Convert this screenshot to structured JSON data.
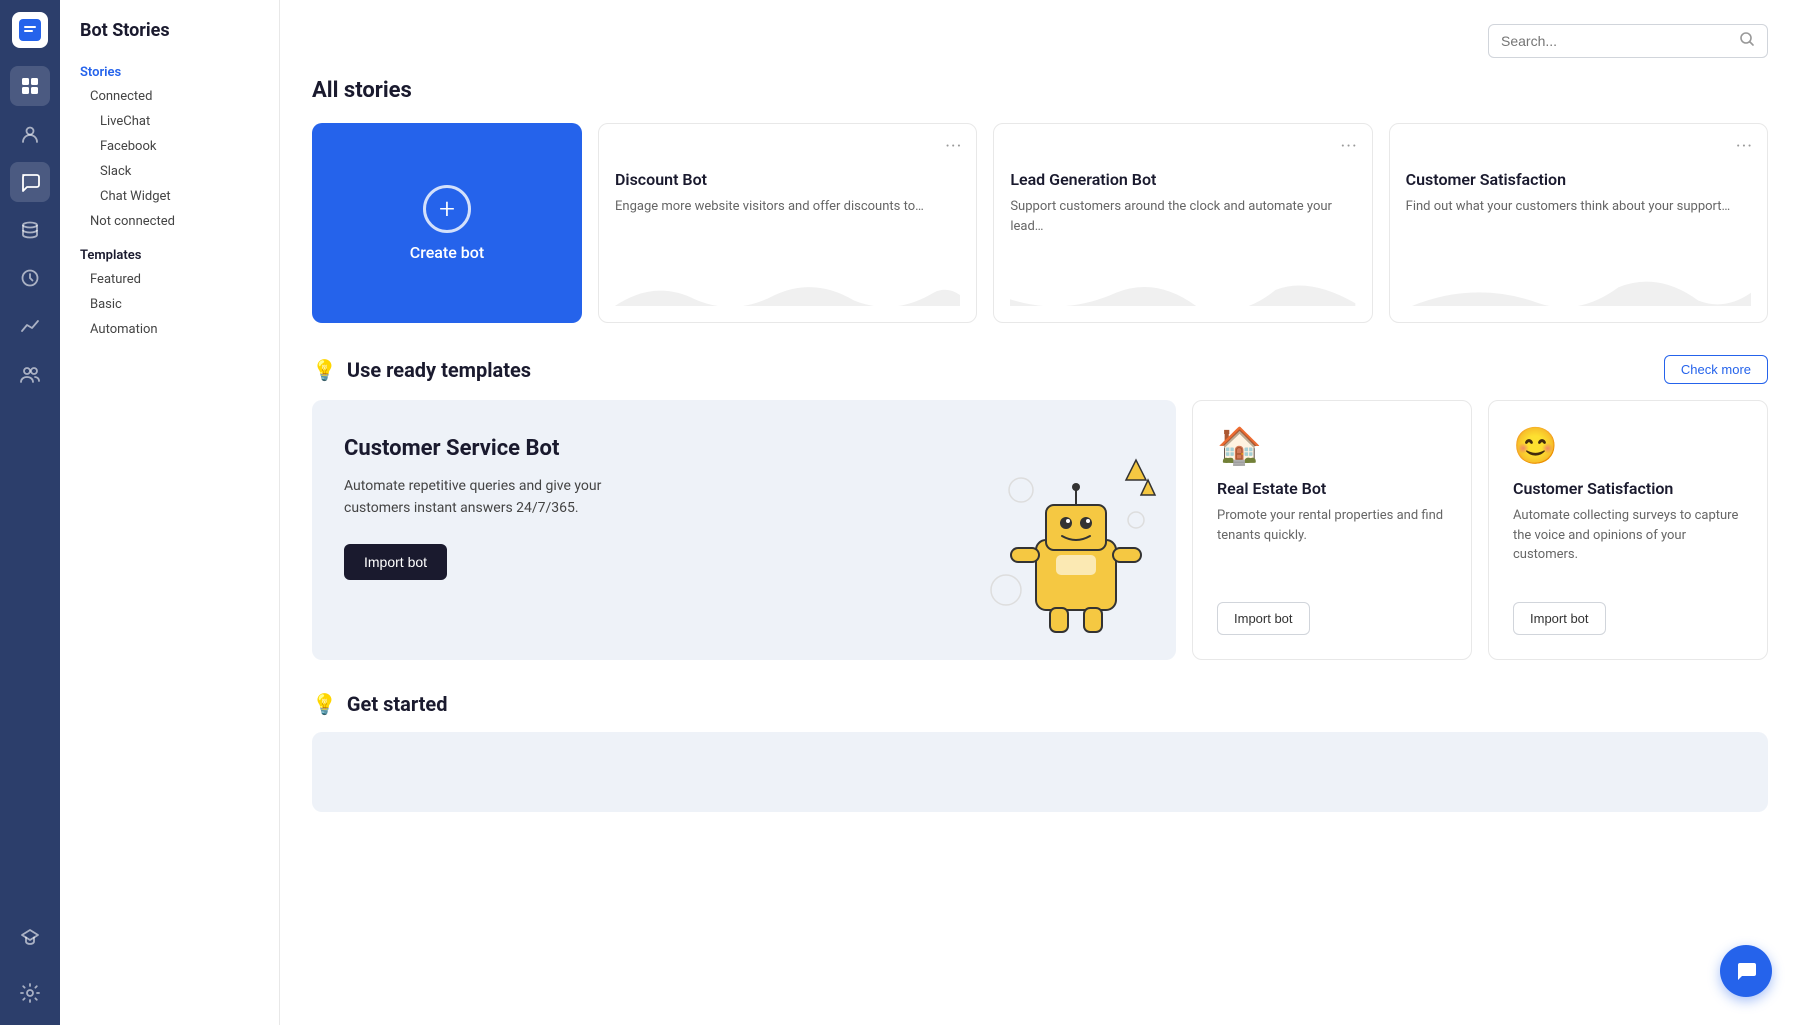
{
  "app": {
    "title": "Bot Stories"
  },
  "nav": {
    "icons": [
      {
        "name": "dashboard-icon",
        "symbol": "⊞",
        "active": false
      },
      {
        "name": "users-icon",
        "symbol": "👤",
        "active": false
      },
      {
        "name": "chat-icon",
        "symbol": "💬",
        "active": true
      },
      {
        "name": "database-icon",
        "symbol": "🗄",
        "active": false
      },
      {
        "name": "clock-icon",
        "symbol": "🕐",
        "active": false
      },
      {
        "name": "analytics-icon",
        "symbol": "📈",
        "active": false
      },
      {
        "name": "team-icon",
        "symbol": "👥",
        "active": false
      },
      {
        "name": "academy-icon",
        "symbol": "🎓",
        "active": false
      },
      {
        "name": "settings-icon",
        "symbol": "⚙",
        "active": false
      }
    ]
  },
  "sidebar": {
    "title": "Bot Stories",
    "stories_label": "Stories",
    "connected_label": "Connected",
    "subitems": [
      {
        "label": "LiveChat"
      },
      {
        "label": "Facebook"
      },
      {
        "label": "Slack"
      },
      {
        "label": "Chat Widget"
      }
    ],
    "not_connected_label": "Not connected",
    "templates_label": "Templates",
    "template_items": [
      {
        "label": "Featured"
      },
      {
        "label": "Basic"
      },
      {
        "label": "Automation"
      }
    ]
  },
  "main": {
    "search_placeholder": "Search...",
    "all_stories_title": "All stories",
    "create_bot_label": "Create bot",
    "bot_cards": [
      {
        "title": "Discount Bot",
        "description": "Engage more website visitors and offer discounts to…"
      },
      {
        "title": "Lead Generation Bot",
        "description": "Support customers around the clock and automate your lead…"
      },
      {
        "title": "Customer Satisfaction",
        "description": "Find out what your customers think about your support…"
      }
    ],
    "templates_section": {
      "title": "Use ready templates",
      "check_more_label": "Check more",
      "featured": {
        "title": "Customer Service Bot",
        "description": "Automate repetitive queries and give your customers instant answers 24/7/365.",
        "import_label": "Import bot"
      },
      "cards": [
        {
          "icon": "🏠",
          "title": "Real Estate Bot",
          "description": "Promote your rental properties and find tenants quickly.",
          "import_label": "Import bot"
        },
        {
          "icon": "😊",
          "title": "Customer Satisfaction",
          "description": "Automate collecting surveys to capture the voice and opinions of your customers.",
          "import_label": "Import bot"
        }
      ]
    },
    "get_started_section": {
      "title": "Get started"
    }
  },
  "float_btn": {
    "label": "💬"
  }
}
